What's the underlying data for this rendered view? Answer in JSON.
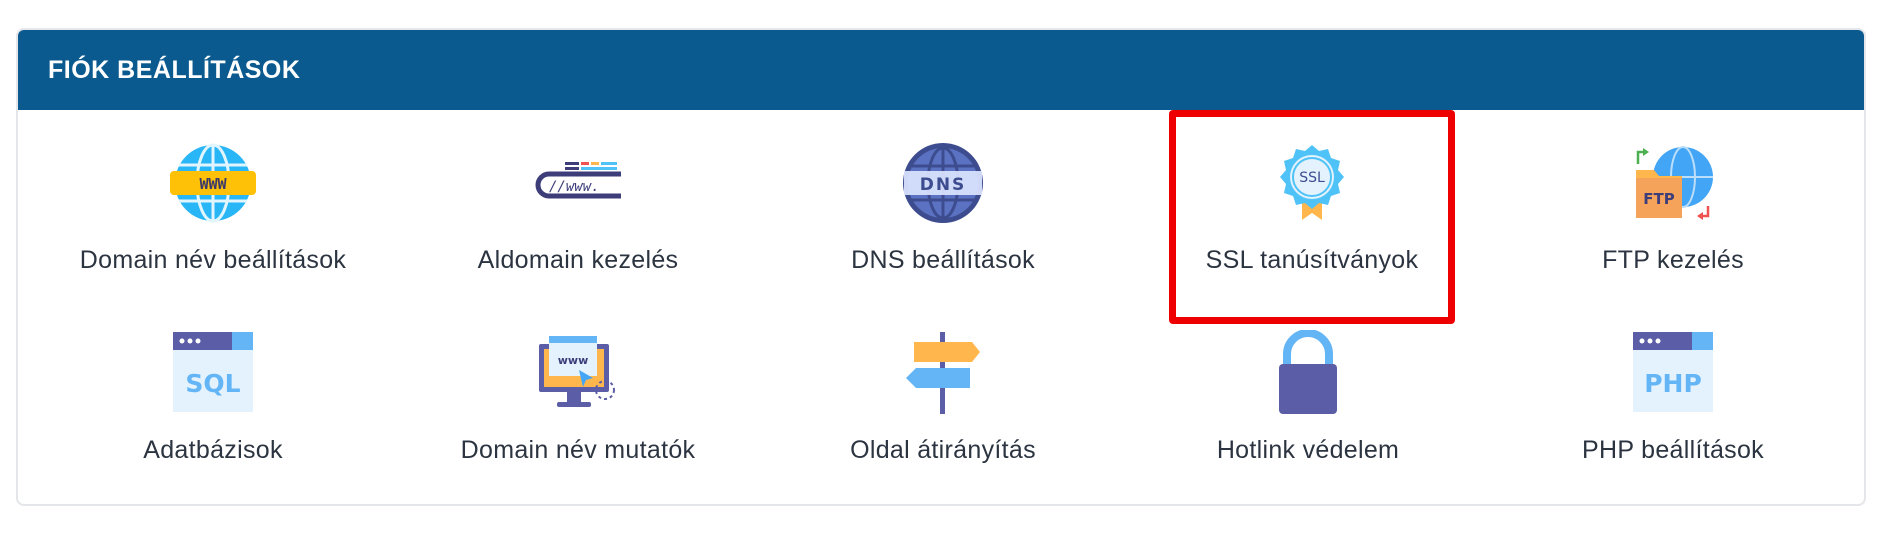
{
  "panel": {
    "title": "FIÓK BEÁLLÍTÁSOK"
  },
  "accent_color": "#0a5a8f",
  "highlight_color": "#ee0000",
  "tiles": [
    {
      "label": "Domain név beállítások",
      "icon": "www-globe-icon"
    },
    {
      "label": "Aldomain kezelés",
      "icon": "url-bar-icon"
    },
    {
      "label": "DNS beállítások",
      "icon": "dns-globe-icon"
    },
    {
      "label": "SSL tanúsítványok",
      "icon": "ssl-badge-icon",
      "highlighted": true
    },
    {
      "label": "FTP kezelés",
      "icon": "ftp-folder-icon"
    },
    {
      "label": "Adatbázisok",
      "icon": "sql-window-icon"
    },
    {
      "label": "Domain név mutatók",
      "icon": "monitor-www-icon"
    },
    {
      "label": "Oldal átirányítás",
      "icon": "signpost-icon"
    },
    {
      "label": "Hotlink védelem",
      "icon": "padlock-icon"
    },
    {
      "label": "PHP beállítások",
      "icon": "php-window-icon"
    }
  ]
}
